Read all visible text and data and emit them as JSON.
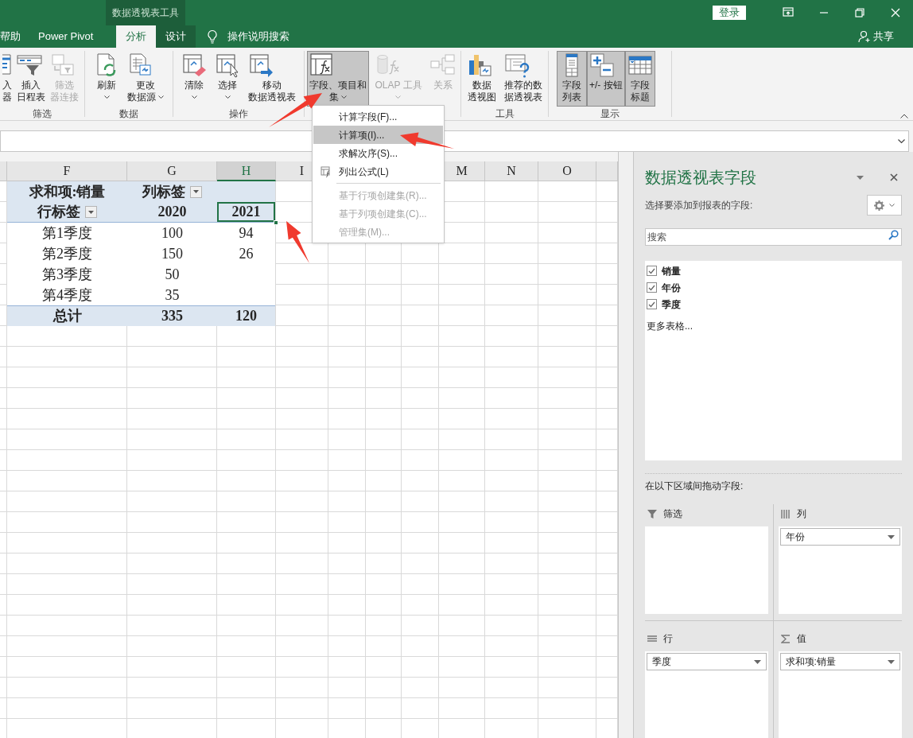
{
  "window": {
    "context_title": "数据透视表工具",
    "login": "登录",
    "share": "共享"
  },
  "tabs": [
    {
      "label": "帮助",
      "selected": false,
      "kind": "main"
    },
    {
      "label": "Power Pivot",
      "selected": false,
      "kind": "main"
    },
    {
      "label": "分析",
      "selected": true,
      "kind": "context"
    },
    {
      "label": "设计",
      "selected": false,
      "kind": "context"
    }
  ],
  "tell_me": "操作说明搜索",
  "ribbon_groups": [
    {
      "label": "筛选",
      "buttons": [
        {
          "lines": [
            "入",
            "器"
          ],
          "disabled": false,
          "pressed": false
        },
        {
          "lines": [
            "插入",
            "日程表"
          ],
          "disabled": false,
          "pressed": false
        },
        {
          "lines": [
            "筛选",
            "器连接"
          ],
          "disabled": true,
          "pressed": false
        }
      ]
    },
    {
      "label": "数据",
      "buttons": [
        {
          "lines": [
            "刷新"
          ],
          "disabled": false,
          "pressed": false,
          "dropdown": true
        },
        {
          "lines": [
            "更改",
            "数据源"
          ],
          "disabled": false,
          "pressed": false,
          "dropdown": true
        }
      ]
    },
    {
      "label": "操作",
      "buttons": [
        {
          "lines": [
            "清除"
          ],
          "disabled": false,
          "pressed": false,
          "dropdown": true
        },
        {
          "lines": [
            "选择"
          ],
          "disabled": false,
          "pressed": false,
          "dropdown": true
        },
        {
          "lines": [
            "移动",
            "数据透视表"
          ],
          "disabled": false,
          "pressed": false
        }
      ]
    },
    {
      "buttons": [
        {
          "lines": [
            "字段、项目和",
            "集"
          ],
          "disabled": false,
          "pressed": true,
          "dropdown": true
        },
        {
          "lines": [
            "OLAP 工具"
          ],
          "disabled": true,
          "pressed": false,
          "dropdown": true
        },
        {
          "lines": [
            "关系"
          ],
          "disabled": true,
          "pressed": false
        }
      ]
    },
    {
      "label": "工具",
      "buttons": [
        {
          "lines": [
            "数据",
            "透视图"
          ],
          "disabled": false,
          "pressed": false
        },
        {
          "lines": [
            "推荐的数",
            "据透视表"
          ],
          "disabled": false,
          "pressed": false
        }
      ]
    },
    {
      "label": "显示",
      "buttons": [
        {
          "lines": [
            "字段",
            "列表"
          ],
          "disabled": false,
          "pressed": true
        },
        {
          "lines": [
            "+/- 按钮"
          ],
          "disabled": false,
          "pressed": true
        },
        {
          "lines": [
            "字段",
            "标题"
          ],
          "disabled": false,
          "pressed": true
        }
      ]
    }
  ],
  "menu": [
    {
      "label": "计算字段(F)...",
      "disabled": false,
      "selected": false
    },
    {
      "label": "计算项(I)...",
      "disabled": false,
      "selected": true
    },
    {
      "label": "求解次序(S)...",
      "disabled": false,
      "selected": false
    },
    {
      "label": "列出公式(L)",
      "disabled": false,
      "selected": false
    },
    {
      "label": "基于行项创建集(R)...",
      "disabled": true,
      "selected": false,
      "divider_before": true
    },
    {
      "label": "基于列项创建集(C)...",
      "disabled": true,
      "selected": false
    },
    {
      "label": "管理集(M)...",
      "disabled": true,
      "selected": false
    }
  ],
  "sheet": {
    "columns": [
      {
        "label": "F",
        "selected": false
      },
      {
        "label": "G",
        "selected": false
      },
      {
        "label": "H",
        "selected": true
      },
      {
        "label": "I",
        "selected": false
      },
      {
        "label": "M",
        "selected": false
      },
      {
        "label": "N",
        "selected": false
      },
      {
        "label": "O",
        "selected": false
      }
    ]
  },
  "pivot": {
    "value_label": "求和项:销量",
    "column_label": "列标签",
    "row_label": "行标签",
    "years": [
      {
        "label": "2020",
        "selected": false
      },
      {
        "label": "2021",
        "selected": true
      }
    ],
    "rows": [
      {
        "label": "第1季度",
        "values": [
          "100",
          "94"
        ]
      },
      {
        "label": "第2季度",
        "values": [
          "150",
          "26"
        ]
      },
      {
        "label": "第3季度",
        "values": [
          "50"
        ]
      },
      {
        "label": "第4季度",
        "values": [
          "35"
        ]
      }
    ],
    "total": {
      "label": "总计",
      "values": [
        "335",
        "120"
      ]
    }
  },
  "field_panel": {
    "title": "数据透视表字段",
    "subtitle": "选择要添加到报表的字段:",
    "search_placeholder": "搜索",
    "fields": [
      {
        "label": "销量",
        "checked": true
      },
      {
        "label": "年份",
        "checked": true
      },
      {
        "label": "季度",
        "checked": true
      }
    ],
    "more_tables": "更多表格...",
    "drag_hint": "在以下区域间拖动字段:",
    "areas": [
      {
        "label": "筛选",
        "kind": "filter"
      },
      {
        "label": "列",
        "kind": "columns",
        "items": [
          "年份"
        ]
      },
      {
        "label": "行",
        "kind": "rows",
        "items": [
          "季度"
        ]
      },
      {
        "label": "值",
        "kind": "values",
        "items": [
          "求和项:销量"
        ]
      }
    ]
  }
}
